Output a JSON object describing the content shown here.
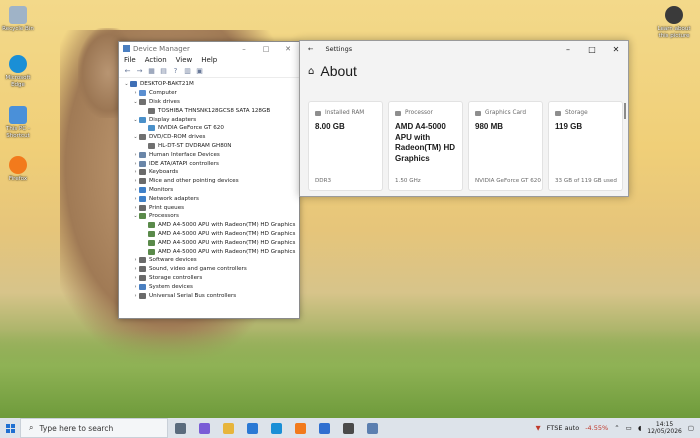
{
  "desktop": {
    "icons": [
      {
        "label": "Recycle Bin",
        "color": "#9fb3c7"
      },
      {
        "label": "Microsoft Edge",
        "color": "#1a8fd6"
      },
      {
        "label": "This PC - Shortcut",
        "color": "#4a90d9"
      },
      {
        "label": "Firefox",
        "color": "#f27a1c"
      },
      {
        "label": "Learn about this picture",
        "color": "#3a3a3a"
      }
    ]
  },
  "device_manager": {
    "title": "Device Manager",
    "window_controls": [
      "–",
      "□",
      "✕"
    ],
    "menu": [
      "File",
      "Action",
      "View",
      "Help"
    ],
    "toolbar": [
      "←",
      "→",
      "▦",
      "▤",
      "?",
      "▥",
      "▣"
    ],
    "tree": [
      {
        "label": "DESKTOP-BAKT21M",
        "level": 0,
        "exp": "⌄",
        "color": "#3f6fb5"
      },
      {
        "label": "Computer",
        "level": 1,
        "exp": "›",
        "color": "#5b8fd0"
      },
      {
        "label": "Disk drives",
        "level": 1,
        "exp": "⌄",
        "color": "#707070"
      },
      {
        "label": "TOSHIBA THNSNK128GCS8 SATA 128GB",
        "level": 2,
        "exp": "",
        "color": "#707070"
      },
      {
        "label": "Display adapters",
        "level": 1,
        "exp": "⌄",
        "color": "#4a90c9"
      },
      {
        "label": "NVIDIA GeForce GT 620",
        "level": 2,
        "exp": "",
        "color": "#4a90c9"
      },
      {
        "label": "DVD/CD-ROM drives",
        "level": 1,
        "exp": "⌄",
        "color": "#707070"
      },
      {
        "label": "HL-DT-ST DVDRAM GH80N",
        "level": 2,
        "exp": "",
        "color": "#707070"
      },
      {
        "label": "Human Interface Devices",
        "level": 1,
        "exp": "›",
        "color": "#6a86a8"
      },
      {
        "label": "IDE ATA/ATAPI controllers",
        "level": 1,
        "exp": "›",
        "color": "#6a86a8"
      },
      {
        "label": "Keyboards",
        "level": 1,
        "exp": "›",
        "color": "#6a6a6a"
      },
      {
        "label": "Mice and other pointing devices",
        "level": 1,
        "exp": "›",
        "color": "#6a6a6a"
      },
      {
        "label": "Monitors",
        "level": 1,
        "exp": "›",
        "color": "#3f80c8"
      },
      {
        "label": "Network adapters",
        "level": 1,
        "exp": "›",
        "color": "#3f80c8"
      },
      {
        "label": "Print queues",
        "level": 1,
        "exp": "›",
        "color": "#6a6a6a"
      },
      {
        "label": "Processors",
        "level": 1,
        "exp": "⌄",
        "color": "#5a8a4a"
      },
      {
        "label": "AMD A4-5000 APU with Radeon(TM) HD Graphics",
        "level": 2,
        "exp": "",
        "color": "#5a8a4a"
      },
      {
        "label": "AMD A4-5000 APU with Radeon(TM) HD Graphics",
        "level": 2,
        "exp": "",
        "color": "#5a8a4a"
      },
      {
        "label": "AMD A4-5000 APU with Radeon(TM) HD Graphics",
        "level": 2,
        "exp": "",
        "color": "#5a8a4a"
      },
      {
        "label": "AMD A4-5000 APU with Radeon(TM) HD Graphics",
        "level": 2,
        "exp": "",
        "color": "#5a8a4a"
      },
      {
        "label": "Software devices",
        "level": 1,
        "exp": "›",
        "color": "#6a6a6a"
      },
      {
        "label": "Sound, video and game controllers",
        "level": 1,
        "exp": "›",
        "color": "#6a6a6a"
      },
      {
        "label": "Storage controllers",
        "level": 1,
        "exp": "›",
        "color": "#6a6a6a"
      },
      {
        "label": "System devices",
        "level": 1,
        "exp": "›",
        "color": "#4a7fc1"
      },
      {
        "label": "Universal Serial Bus controllers",
        "level": 1,
        "exp": "›",
        "color": "#6a6a6a"
      }
    ]
  },
  "settings": {
    "title": "Settings",
    "back": "←",
    "window_controls": [
      "–",
      "□",
      "✕"
    ],
    "heading": "About",
    "home_icon": "⌂",
    "cards": [
      {
        "label": "Installed RAM",
        "value": "8.00 GB",
        "footer": "DDR3"
      },
      {
        "label": "Processor",
        "value": "AMD A4-5000 APU with Radeon(TM) HD Graphics",
        "footer": "1.50 GHz"
      },
      {
        "label": "Graphics Card",
        "value": "980 MB",
        "footer": "NVIDIA GeForce GT 620"
      },
      {
        "label": "Storage",
        "value": "119 GB",
        "footer": "33 GB of 119 GB used"
      }
    ]
  },
  "taskbar": {
    "search_placeholder": "Type here to search",
    "apps": [
      {
        "name": "task-view",
        "color": "#5a6b7d"
      },
      {
        "name": "copilot",
        "color": "#7a5cd6"
      },
      {
        "name": "file-explorer",
        "color": "#e7b53c"
      },
      {
        "name": "mail",
        "color": "#2b79d4"
      },
      {
        "name": "edge",
        "color": "#1a8fd6"
      },
      {
        "name": "firefox",
        "color": "#f27a1c"
      },
      {
        "name": "store",
        "color": "#2f6fd0"
      },
      {
        "name": "settings",
        "color": "#4a4a4a"
      },
      {
        "name": "device-manager",
        "color": "#5b7fb0"
      }
    ],
    "market": {
      "label": "FTSE auto",
      "change": "-4.55%"
    },
    "time": "14:15",
    "date": "12/05/2026"
  }
}
